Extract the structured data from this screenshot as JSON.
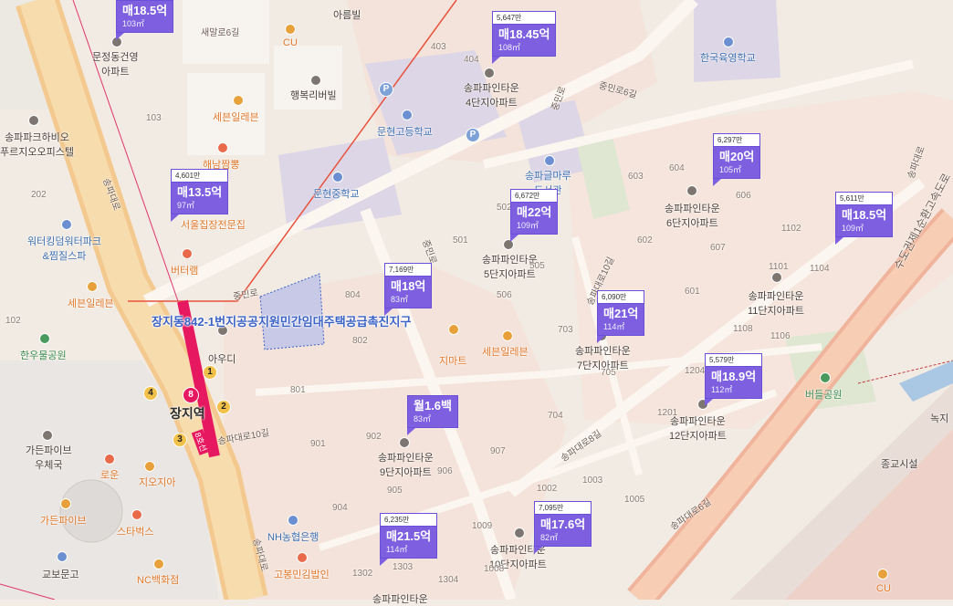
{
  "colors": {
    "listing_tag": "#7d5fe0",
    "zone_outline": "#3b62c7",
    "boundary": "#e8513b"
  },
  "station": {
    "name": "장지역",
    "line_badge": "8",
    "exit_numbers": [
      "1",
      "2",
      "3",
      "4"
    ],
    "line_label": "8호선"
  },
  "zone_label": "장지동842-1번지공공지원민간임대주택공급촉진지구",
  "listings": [
    {
      "top": "",
      "price": "매18.5억",
      "area": "103㎡"
    },
    {
      "top": "5,647만",
      "price": "매18.45억",
      "area": "108㎡"
    },
    {
      "top": "6,297만",
      "price": "매20억",
      "area": "105㎡"
    },
    {
      "top": "4,601만",
      "price": "매13.5억",
      "area": "97㎡"
    },
    {
      "top": "6,672만",
      "price": "매22억",
      "area": "109㎡"
    },
    {
      "top": "5,611만",
      "price": "매18.5억",
      "area": "109㎡"
    },
    {
      "top": "7,169만",
      "price": "매18억",
      "area": "83㎡"
    },
    {
      "top": "6,090만",
      "price": "매21억",
      "area": "114㎡"
    },
    {
      "top": "5,579만",
      "price": "매18.9억",
      "area": "112㎡"
    },
    {
      "top": "",
      "price": "월1.6백",
      "area": "83㎡"
    },
    {
      "top": "6,235만",
      "price": "매21.5억",
      "area": "114㎡"
    },
    {
      "top": "7,095만",
      "price": "매17.6억",
      "area": "82㎡"
    }
  ],
  "labels": {
    "arumvil": "아름빌",
    "semalro6": "새말로6길",
    "cu1": "CU",
    "munjeong": "문정동건영\n아파트",
    "haengbok": "행복리버빌",
    "sebin1": "세븐일레븐",
    "hanguk": "한국육영학교",
    "apt4": "송파파인타운\n4단지아파트",
    "munhyeonhigh": "문현고등학교",
    "songpalib": "송파글마루\n도서관",
    "munhyeonmid": "문현중학교",
    "apt6": "송파파인타운\n6단지아파트",
    "apt5": "송파파인타운\n5단지아파트",
    "apt11": "송파파인타운\n11단지아파트",
    "haenam": "해남짬뽕",
    "seoulsangga": "서울집장전문집",
    "songpapark": "송파파크하비오\n푸르지오오피스텔",
    "waterking": "워터킹덤워터파크\n&찜질스파",
    "butterlam": "버터램",
    "sebin2": "세븐일레븐",
    "hanumul": "한우물공원",
    "audi": "아우디",
    "gmart": "지마트",
    "sebin3": "세븐일레븐",
    "apt7": "송파파인타운\n7단지아파트",
    "beodeul": "버들공원",
    "apt12": "송파파인타운\n12단지아파트",
    "apt9": "송파파인타운\n9단지아파트",
    "garden_post": "가든파이브\n우체국",
    "rowoon": "로운",
    "jioji": "지오지아",
    "gardenfive": "가든파이브",
    "starbucks": "스타벅스",
    "nh": "NH농협은행",
    "kyobo": "교보문고",
    "nc": "NC백화점",
    "gobong": "고봉민김밥인",
    "apt10": "송파파인타운\n10단지아파트",
    "apt_bottom": "송파파인타운",
    "religion": "종교시설",
    "greenery": "녹지",
    "cu2": "CU",
    "expressway": "수도권제1순환고속도로",
    "rd_jungmin6": "중민로6길",
    "rd_jungmin": "중민로",
    "rd_songpa": "송파대로",
    "rd_songpa6": "송파대로6길",
    "rd_songpa8": "송파대로8길",
    "rd_songpa10": "송파대로10길",
    "rd_songpa10b": "송파대로10길",
    "rd_jungmin2": "중민로",
    "rd_songpadaero2": "송파대로"
  },
  "block_numbers": [
    "403",
    "404",
    "103",
    "202",
    "102",
    "804",
    "802",
    "801",
    "505",
    "501",
    "502",
    "506",
    "603",
    "604",
    "602",
    "601",
    "606",
    "607",
    "1102",
    "1104",
    "1101",
    "1108",
    "1106",
    "703",
    "705",
    "704",
    "1204",
    "1201",
    "902",
    "901",
    "907",
    "906",
    "904",
    "905",
    "1002",
    "1003",
    "1005",
    "1009",
    "1008",
    "1304",
    "1302",
    "1303"
  ]
}
